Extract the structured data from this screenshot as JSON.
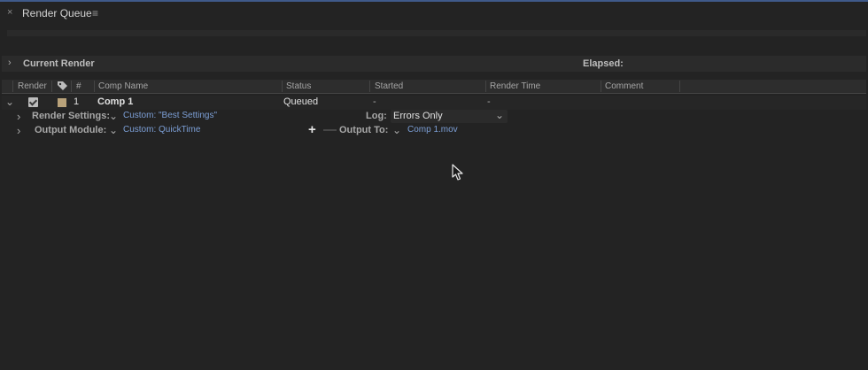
{
  "panel": {
    "title": "Render Queue",
    "close_glyph": "×",
    "menu_glyph": "≡",
    "accent_color": "#3f5a8a"
  },
  "current_render": {
    "label": "Current Render",
    "elapsed_label": "Elapsed:",
    "chevron_icon": "chevron-right-icon"
  },
  "columns": {
    "render": "Render",
    "label_icon": "tag-icon",
    "number": "#",
    "comp_name": "Comp Name",
    "status": "Status",
    "started": "Started",
    "render_time": "Render Time",
    "comment": "Comment"
  },
  "item": {
    "checked": true,
    "label_color": "#b9a27a",
    "number": "1",
    "comp_name": "Comp 1",
    "status": "Queued",
    "started": "-",
    "render_time": "-",
    "render_settings_label": "Render Settings:",
    "render_settings_value": "Custom: \"Best Settings\"",
    "log_label": "Log:",
    "log_value": "Errors Only",
    "output_module_label": "Output Module:",
    "output_module_value": "Custom: QuickTime",
    "output_to_label": "Output To:",
    "output_to_value": "Comp 1.mov",
    "add_glyph": "+",
    "remove_glyph": "—"
  },
  "glyphs": {
    "chevron_right": "›",
    "chevron_down": "⌄"
  },
  "link_color": "#7c9fd6"
}
